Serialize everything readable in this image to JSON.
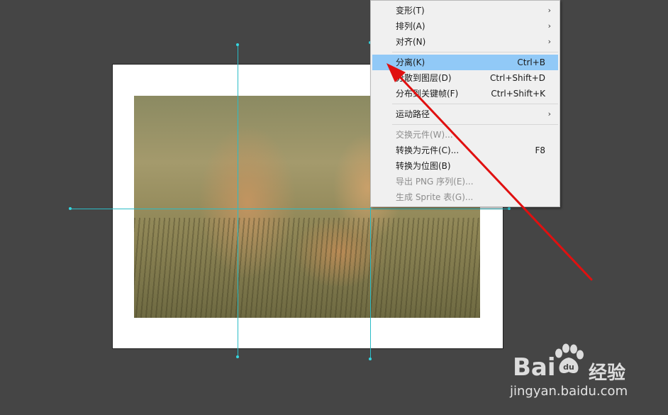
{
  "context_menu": {
    "items": [
      {
        "label": "变形(T)",
        "shortcut": "",
        "submenu": true,
        "enabled": true,
        "highlighted": false
      },
      {
        "label": "排列(A)",
        "shortcut": "",
        "submenu": true,
        "enabled": true,
        "highlighted": false
      },
      {
        "label": "对齐(N)",
        "shortcut": "",
        "submenu": true,
        "enabled": true,
        "highlighted": false
      },
      {
        "label": "分离(K)",
        "shortcut": "Ctrl+B",
        "submenu": false,
        "enabled": true,
        "highlighted": true
      },
      {
        "label": "分散到图层(D)",
        "shortcut": "Ctrl+Shift+D",
        "submenu": false,
        "enabled": true,
        "highlighted": false
      },
      {
        "label": "分布到关键帧(F)",
        "shortcut": "Ctrl+Shift+K",
        "submenu": false,
        "enabled": true,
        "highlighted": false
      },
      {
        "label": "运动路径",
        "shortcut": "",
        "submenu": true,
        "enabled": true,
        "highlighted": false
      },
      {
        "label": "交换元件(W)...",
        "shortcut": "",
        "submenu": false,
        "enabled": false,
        "highlighted": false
      },
      {
        "label": "转换为元件(C)...",
        "shortcut": "F8",
        "submenu": false,
        "enabled": true,
        "highlighted": false
      },
      {
        "label": "转换为位图(B)",
        "shortcut": "",
        "submenu": false,
        "enabled": true,
        "highlighted": false
      },
      {
        "label": "导出 PNG 序列(E)...",
        "shortcut": "",
        "submenu": false,
        "enabled": false,
        "highlighted": false
      },
      {
        "label": "生成 Sprite 表(G)...",
        "shortcut": "",
        "submenu": false,
        "enabled": false,
        "highlighted": false
      }
    ],
    "submenu_glyph": "›"
  },
  "watermark": {
    "brand": "Bai du 经验",
    "brand_left": "Bai",
    "brand_right": "du",
    "brand_cn": "经验",
    "url": "jingyan.baidu.com"
  },
  "colors": {
    "canvas_bg": "#454545",
    "guide": "#2bbcc6",
    "menu_highlight": "#91c9f7",
    "annotation_arrow": "#e01010"
  },
  "icons": {
    "submenu_arrow": "chevron-right-icon",
    "annotation": "red-arrow-icon",
    "watermark": "baidu-paw-icon"
  }
}
